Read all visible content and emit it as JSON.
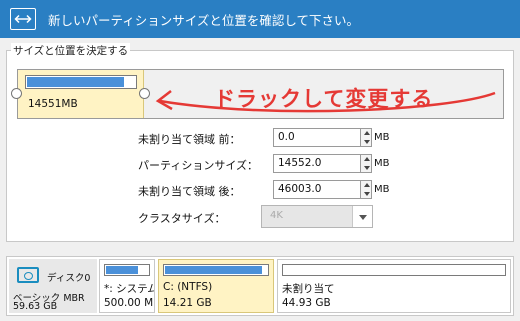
{
  "header": {
    "title": "新しいパーティションサイズと位置を確認して下さい。",
    "icon": "resize-arrows-icon"
  },
  "group": {
    "legend": "サイズと位置を決定する",
    "partition": {
      "size_label": "14551MB",
      "used_fraction": 0.9
    },
    "annotation": "ドラックして変更する"
  },
  "form": {
    "unalloc_before": {
      "label": "未割り当て領域 前：",
      "value": "0.0",
      "unit": "MB"
    },
    "partition_size": {
      "label": "パーティションサイズ：",
      "value": "14552.0",
      "unit": "MB"
    },
    "unalloc_after": {
      "label": "未割り当て領域 後：",
      "value": "46003.0",
      "unit": "MB"
    },
    "cluster_size": {
      "label": "クラスタサイズ：",
      "value": "4K"
    }
  },
  "disk": {
    "name": "ディスク0",
    "type": "ベーシック MBR",
    "size": "59.63 GB",
    "partitions": [
      {
        "name": "*: システム…",
        "size": "500.00 MB",
        "used_fraction": 0.75,
        "selected": false
      },
      {
        "name": "C: (NTFS)",
        "size": "14.21 GB",
        "used_fraction": 0.95,
        "selected": true
      },
      {
        "name": "未割り当て",
        "size": "44.93 GB",
        "used_fraction": 0.0,
        "selected": false
      }
    ]
  },
  "colors": {
    "header_bg": "#2a7fc3",
    "accent": "#4a90d9",
    "selected_partition": "#fff3c4",
    "annotation": "#e53935"
  }
}
